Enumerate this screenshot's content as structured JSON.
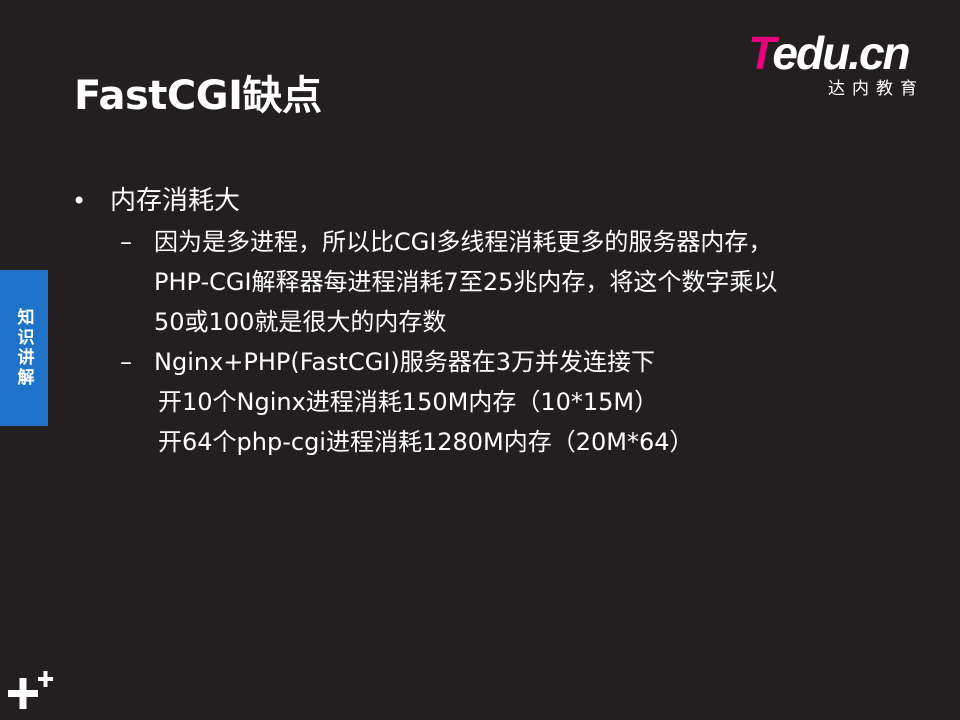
{
  "slide": {
    "title": "FastCGI缺点"
  },
  "logo": {
    "brand_t": "T",
    "brand_rest": "edu.cn",
    "subtitle": "达内教育"
  },
  "side_tab": {
    "label": "知识讲解"
  },
  "content": {
    "bullet": {
      "marker": "•",
      "text": "内存消耗大"
    },
    "sub_items": [
      {
        "dash": "–",
        "lines": [
          "因为是多进程，所以比CGI多线程消耗更多的服务器内存，",
          "PHP-CGI解释器每进程消耗7至25兆内存，将这个数字乘以",
          "50或100就是很大的内存数"
        ]
      },
      {
        "dash": "–",
        "lines": [
          "Nginx+PHP(FastCGI)服务器在3万并发连接下"
        ]
      }
    ],
    "extra_lines": [
      "开10个Nginx进程消耗150M内存（10*15M）",
      "开64个php-cgi进程消耗1280M内存（20M*64）"
    ]
  },
  "colors": {
    "background": "#231f20",
    "accent_blue": "#1e73c8",
    "logo_pink": "#e6007e",
    "text": "#ffffff"
  },
  "icons": {
    "corner": "plus-plus-icon"
  }
}
